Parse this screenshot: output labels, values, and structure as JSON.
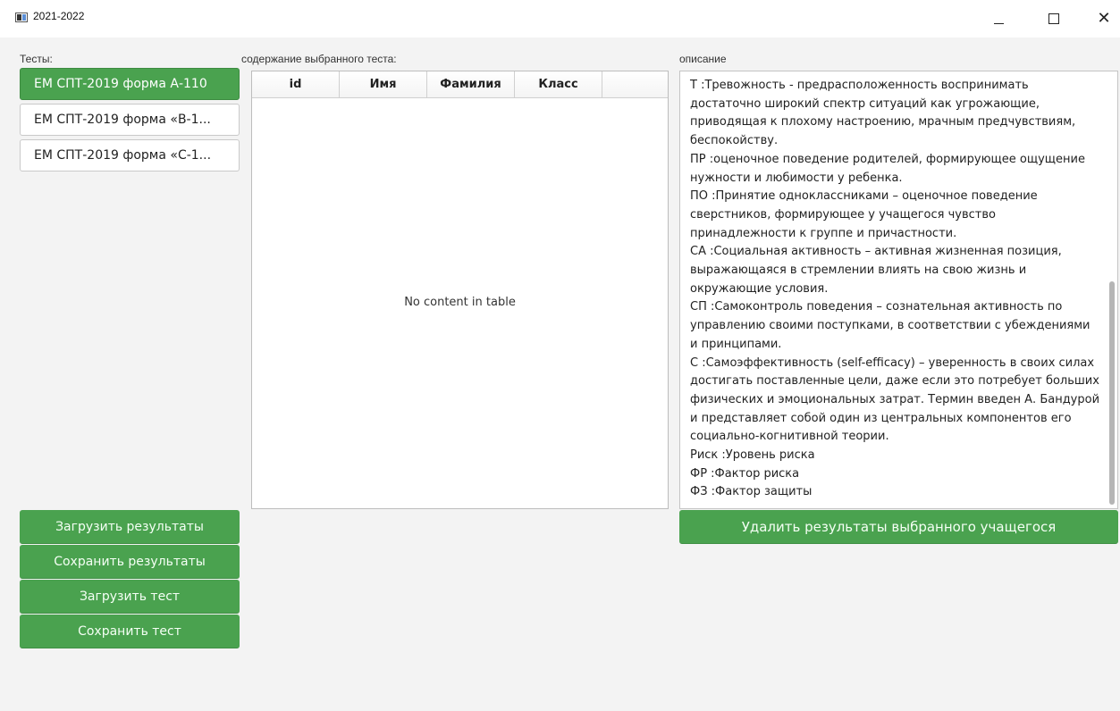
{
  "window": {
    "title": "2021-2022",
    "minimize_glyph": "—",
    "maximize_glyph": "☐",
    "close_glyph": "✕"
  },
  "labels": {
    "tests": "Тесты:",
    "content": "содержание выбранного теста:",
    "description": "описание"
  },
  "tests": [
    {
      "label": "ЕМ СПТ-2019 форма А-110",
      "selected": true
    },
    {
      "label": "ЕМ СПТ-2019 форма «В-1...",
      "selected": false
    },
    {
      "label": "ЕМ СПТ-2019 форма «С-1...",
      "selected": false
    }
  ],
  "table": {
    "columns": [
      "id",
      "Имя",
      "Фамилия",
      "Класс",
      ""
    ],
    "empty_message": "No content in table"
  },
  "description": {
    "text": "Т :Тревожность - предрасположенность воспринимать достаточно широкий спектр ситуаций как угрожающие, приводящая к плохому настроению, мрачным предчувствиям, беспокойству.\nПР :оценочное поведение родителей, формирующее ощущение нужности и любимости у ребенка.\nПО :Принятие одноклассниками – оценочное поведение сверстников, формирующее у учащегося чувство принадлежности к группе и причастности.\nСА :Социальная активность – активная жизненная позиция, выражающаяся в стремлении влиять на свою жизнь и окружающие условия.\nСП :Самоконтроль поведения – сознательная активность по управлению своими поступками, в соответствии с убеждениями и принципами.\nС :Самоэффективность (self-efficacy) – уверенность в своих силах достигать поставленные цели, даже если это потребует больших физических и эмоциональных затрат. Термин введен А. Бандурой и представляет собой один из центральных компонентов его социально-когнитивной теории.\nРиск :Уровень риска\nФР :Фактор риска\nФЗ :Фактор защиты"
  },
  "buttons": {
    "load_results": "Загрузить результаты",
    "save_results": "Сохранить результаты",
    "load_test": "Загрузить тест",
    "save_test": "Сохранить тест",
    "delete_student_results": "Удалить результаты выбранного учащегося"
  },
  "colors": {
    "accent_green": "#4aa24f",
    "background": "#f3f3f3"
  }
}
